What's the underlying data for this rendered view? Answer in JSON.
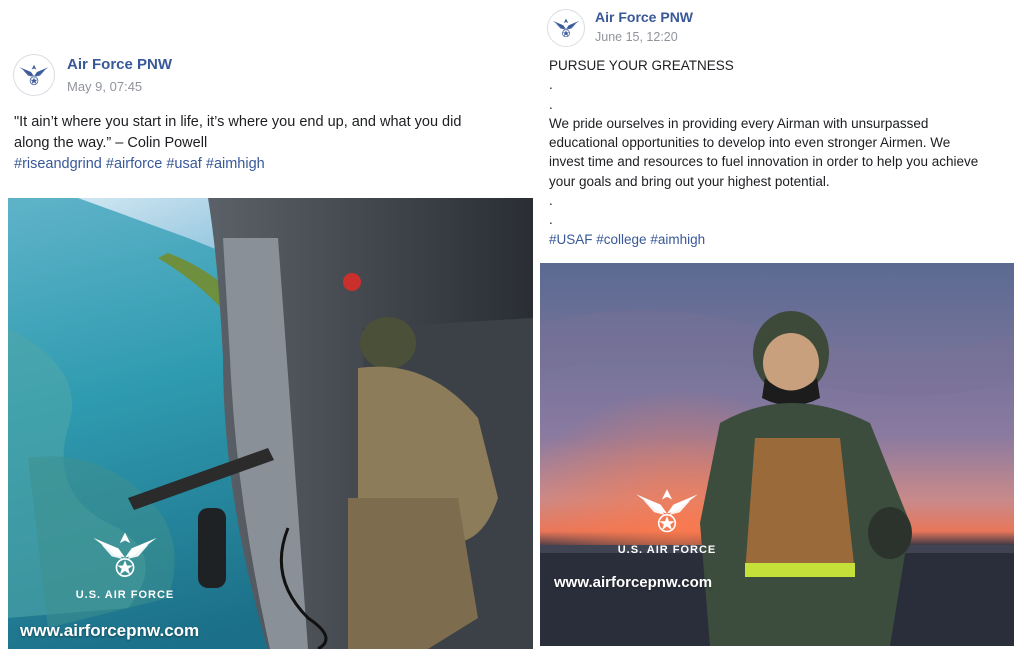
{
  "colors": {
    "link": "#385898",
    "meta": "#90949c",
    "text": "#1c1e21"
  },
  "posts": [
    {
      "author": "Air Force PNW",
      "avatar_icon": "air-force-wings-icon",
      "timestamp": "May 9, 07:45",
      "text_lines": [
        "\"It ain’t where you start in life, it’s where you end up, and what you did",
        "along the way.”  – Colin Powell"
      ],
      "hashtags": [
        "#riseandgrind",
        "#airforce",
        "#usaf",
        "#aimhigh"
      ],
      "photo": {
        "description_icon": "helicopter-gunner-over-reef-photo",
        "brand_label": "U.S. AIR FORCE",
        "url": "www.airforcepnw.com"
      }
    },
    {
      "author": "Air Force PNW",
      "avatar_icon": "air-force-wings-icon",
      "timestamp": "June 15, 12:20",
      "headline": "PURSUE YOUR GREATNESS",
      "dots_a": [
        ".",
        "."
      ],
      "text_lines": [
        "We pride ourselves in providing every Airman with unsurpassed",
        "educational opportunities to develop into even stronger Airmen. We",
        "invest time and resources to fuel innovation in order to help you achieve",
        "your goals and bring out your highest potential."
      ],
      "dots_b": [
        ".",
        "."
      ],
      "hashtags": [
        "#USAF",
        "#college",
        "#aimhigh"
      ],
      "photo": {
        "description_icon": "airman-at-sunset-photo",
        "brand_label": "U.S. AIR FORCE",
        "url": "www.airforcepnw.com"
      }
    }
  ]
}
